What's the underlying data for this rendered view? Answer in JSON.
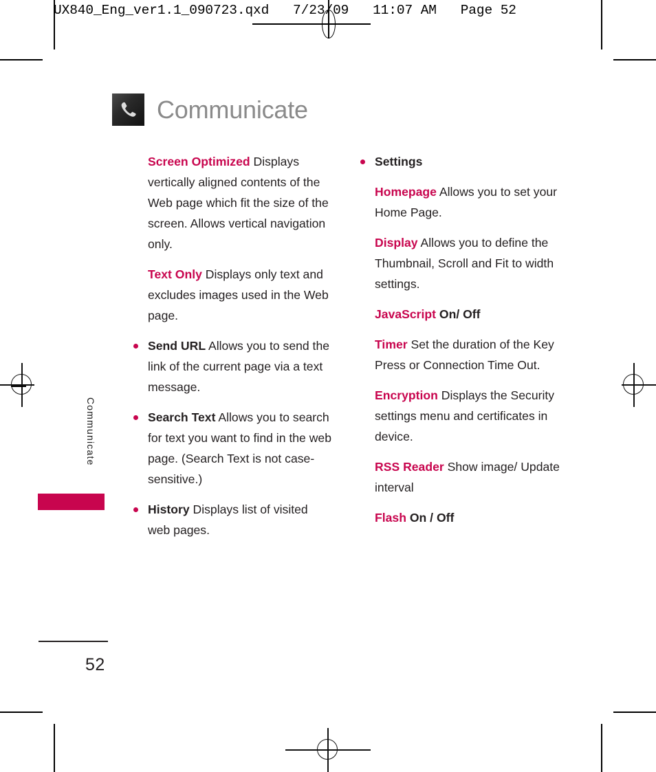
{
  "prepress": {
    "slug": "UX840_Eng_ver1.1_090723.qxd   7/23/09   11:07 AM   Page 52",
    "registration_icon": "registration-target-icon",
    "crop_mark_icon": "crop-mark-icon"
  },
  "title": {
    "heading": "Communicate",
    "icon": "phone-handset-icon",
    "icon_bg": "#1a1a1a",
    "text_color": "#8a8a8a"
  },
  "side_tab": {
    "label": "Communicate",
    "block_color": "#c8054e"
  },
  "theme": {
    "accent": "#c8054e",
    "body_text": "#231f20"
  },
  "left_column": [
    {
      "kind": "paragraph",
      "term": "Screen Optimized",
      "term_style": "accent",
      "body": " Displays vertically aligned contents of the Web page which fit the size of the screen. Allows vertical navigation only."
    },
    {
      "kind": "paragraph",
      "term": "Text Only",
      "term_style": "accent",
      "body": " Displays only text and excludes images used in the Web page."
    },
    {
      "kind": "bullet",
      "term": "Send URL",
      "term_style": "dark",
      "body": " Allows you to send the link of the current page via a text message."
    },
    {
      "kind": "bullet",
      "term": "Search Text",
      "term_style": "dark",
      "body": " Allows  you to search for text you want to find in the web page. (Search Text is not case-sensitive.)"
    },
    {
      "kind": "bullet",
      "term": "History",
      "term_style": "dark",
      "body": " Displays list of visited web pages."
    }
  ],
  "right_column": [
    {
      "kind": "bullet",
      "term": "Settings",
      "term_style": "dark",
      "body": ""
    },
    {
      "kind": "paragraph",
      "term": "Homepage",
      "term_style": "accent",
      "body": " Allows you to set your Home Page."
    },
    {
      "kind": "paragraph",
      "term": "Display",
      "term_style": "accent",
      "body": " Allows you to define the Thumbnail, Scroll and Fit to width settings."
    },
    {
      "kind": "paragraph",
      "term": "JavaScript",
      "term_style": "accent",
      "body": "",
      "value": "  On/ Off"
    },
    {
      "kind": "paragraph",
      "term": "Timer",
      "term_style": "accent",
      "body": " Set the duration of the Key Press or Connection Time Out."
    },
    {
      "kind": "paragraph",
      "term": "Encryption",
      "term_style": "accent",
      "body": " Displays the Security settings menu and certificates in device."
    },
    {
      "kind": "paragraph",
      "term": "RSS Reader",
      "term_style": "accent",
      "body": " Show image/ Update interval"
    },
    {
      "kind": "paragraph",
      "term": "Flash",
      "term_style": "accent",
      "body": "",
      "value": "  On / Off"
    }
  ],
  "footer": {
    "page_number": "52"
  }
}
